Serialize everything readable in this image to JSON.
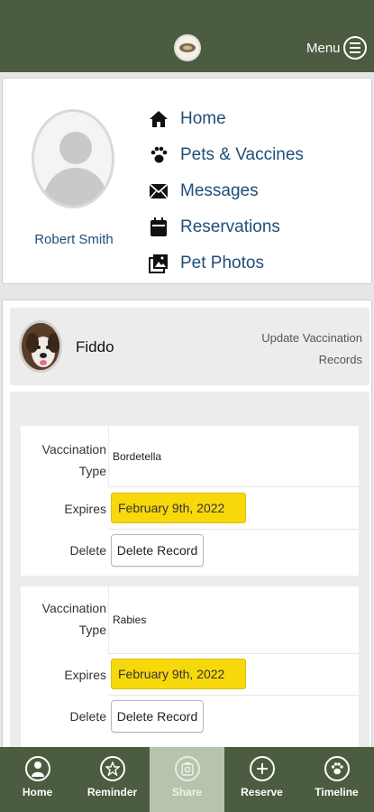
{
  "header": {
    "menu_label": "Menu"
  },
  "profile": {
    "user_name": "Robert Smith",
    "nav": [
      {
        "label": "Home",
        "icon": "home-icon"
      },
      {
        "label": "Pets & Vaccines",
        "icon": "paw-icon"
      },
      {
        "label": "Messages",
        "icon": "envelope-icon"
      },
      {
        "label": "Reservations",
        "icon": "calendar-icon"
      },
      {
        "label": "Pet Photos",
        "icon": "photos-icon"
      }
    ]
  },
  "pet": {
    "name": "Fiddo",
    "update_link": "Update Vaccination Records",
    "labels": {
      "type": "Vaccination Type",
      "expires": "Expires",
      "delete": "Delete"
    },
    "records": [
      {
        "type": "Bordetella",
        "expires": "February 9th, 2022",
        "delete_label": "Delete Record"
      },
      {
        "type": "Rabies",
        "expires": "February 9th, 2022",
        "delete_label": "Delete Record"
      }
    ]
  },
  "bottom_nav": {
    "tabs": [
      {
        "label": "Home",
        "icon": "user-circle-icon"
      },
      {
        "label": "Reminder",
        "icon": "star-icon"
      },
      {
        "label": "Share",
        "icon": "camera-icon",
        "active": true
      },
      {
        "label": "Reserve",
        "icon": "plus-icon"
      },
      {
        "label": "Timeline",
        "icon": "paw-icon"
      }
    ]
  },
  "colors": {
    "header_bg": "#4b5c40",
    "link": "#1f4e79",
    "date_bg": "#f7d80a",
    "active_tab": "#b7c4ad"
  }
}
